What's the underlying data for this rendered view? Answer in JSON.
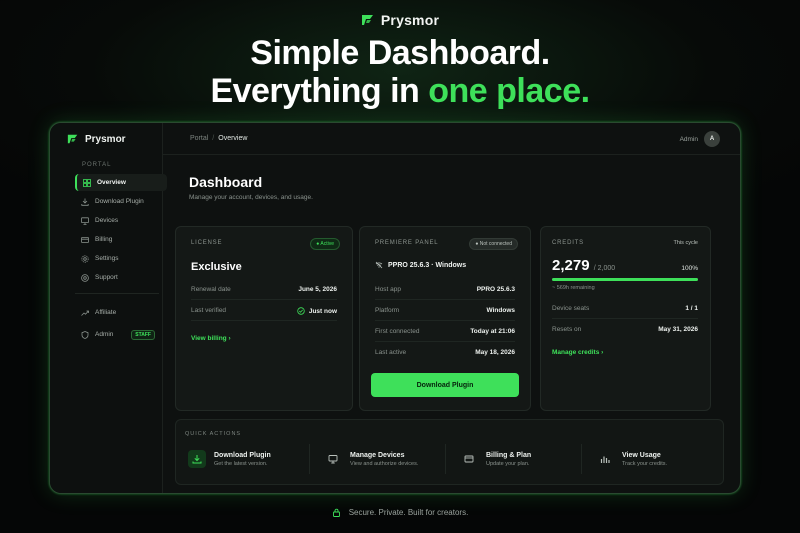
{
  "brand": {
    "name": "Prysmor"
  },
  "hero": {
    "line1": "Simple Dashboard.",
    "line2_prefix": "Everything in ",
    "line2_accent": "one place."
  },
  "colors": {
    "accent": "#3ee05a",
    "background": "#070a08",
    "panel": "#141816"
  },
  "sidebar": {
    "brand": "Prysmor",
    "section": "PORTAL",
    "items": [
      {
        "label": "Overview",
        "icon": "grid-icon",
        "active": true
      },
      {
        "label": "Download Plugin",
        "icon": "download-icon"
      },
      {
        "label": "Devices",
        "icon": "monitor-icon"
      },
      {
        "label": "Billing",
        "icon": "card-icon"
      },
      {
        "label": "Settings",
        "icon": "gear-icon"
      },
      {
        "label": "Support",
        "icon": "help-icon"
      }
    ],
    "extra": [
      {
        "label": "Affiliate",
        "icon": "trend-icon"
      },
      {
        "label": "Admin",
        "icon": "shield-icon",
        "badge": "STAFF"
      }
    ]
  },
  "topbar": {
    "crumb_root": "Portal",
    "crumb_sep": "/",
    "crumb_current": "Overview",
    "user": "Admin",
    "avatar": "A"
  },
  "page": {
    "title": "Dashboard",
    "subtitle": "Manage your account, devices, and usage."
  },
  "license": {
    "label": "LICENSE",
    "status": "Active",
    "plan": "Exclusive",
    "rows": [
      {
        "k": "Renewal date",
        "v": "June 5, 2026"
      },
      {
        "k": "Last verified",
        "v": "Just now"
      }
    ],
    "link": "View billing"
  },
  "premiere": {
    "label": "PREMIERE PANEL",
    "status": "Not connected",
    "device": "PPRO 25.6.3 · Windows",
    "rows": [
      {
        "k": "Host app",
        "v": "PPRO 25.6.3"
      },
      {
        "k": "Platform",
        "v": "Windows"
      },
      {
        "k": "First connected",
        "v": "Today at 21:06"
      },
      {
        "k": "Last active",
        "v": "May 18, 2026"
      }
    ],
    "button": "Download Plugin"
  },
  "credits": {
    "label": "CREDITS",
    "cycle": "This cycle",
    "used": "2,279",
    "total": "/ 2,000",
    "percent": "100%",
    "fill_fraction": 1.0,
    "remaining": "~ 569h remaining",
    "rows": [
      {
        "k": "Device seats",
        "v": "1 / 1"
      },
      {
        "k": "Resets on",
        "v": "May 31, 2026"
      }
    ],
    "link": "Manage credits"
  },
  "quick_actions": {
    "label": "QUICK ACTIONS",
    "items": [
      {
        "title": "Download Plugin",
        "desc": "Get the latest version.",
        "icon": "download-icon"
      },
      {
        "title": "Manage Devices",
        "desc": "View and authorize devices.",
        "icon": "monitor-icon"
      },
      {
        "title": "Billing & Plan",
        "desc": "Update your plan.",
        "icon": "card-icon"
      },
      {
        "title": "View Usage",
        "desc": "Track your credits.",
        "icon": "chart-icon"
      }
    ]
  },
  "footer": {
    "text": "Secure. Private. Built for creators."
  }
}
